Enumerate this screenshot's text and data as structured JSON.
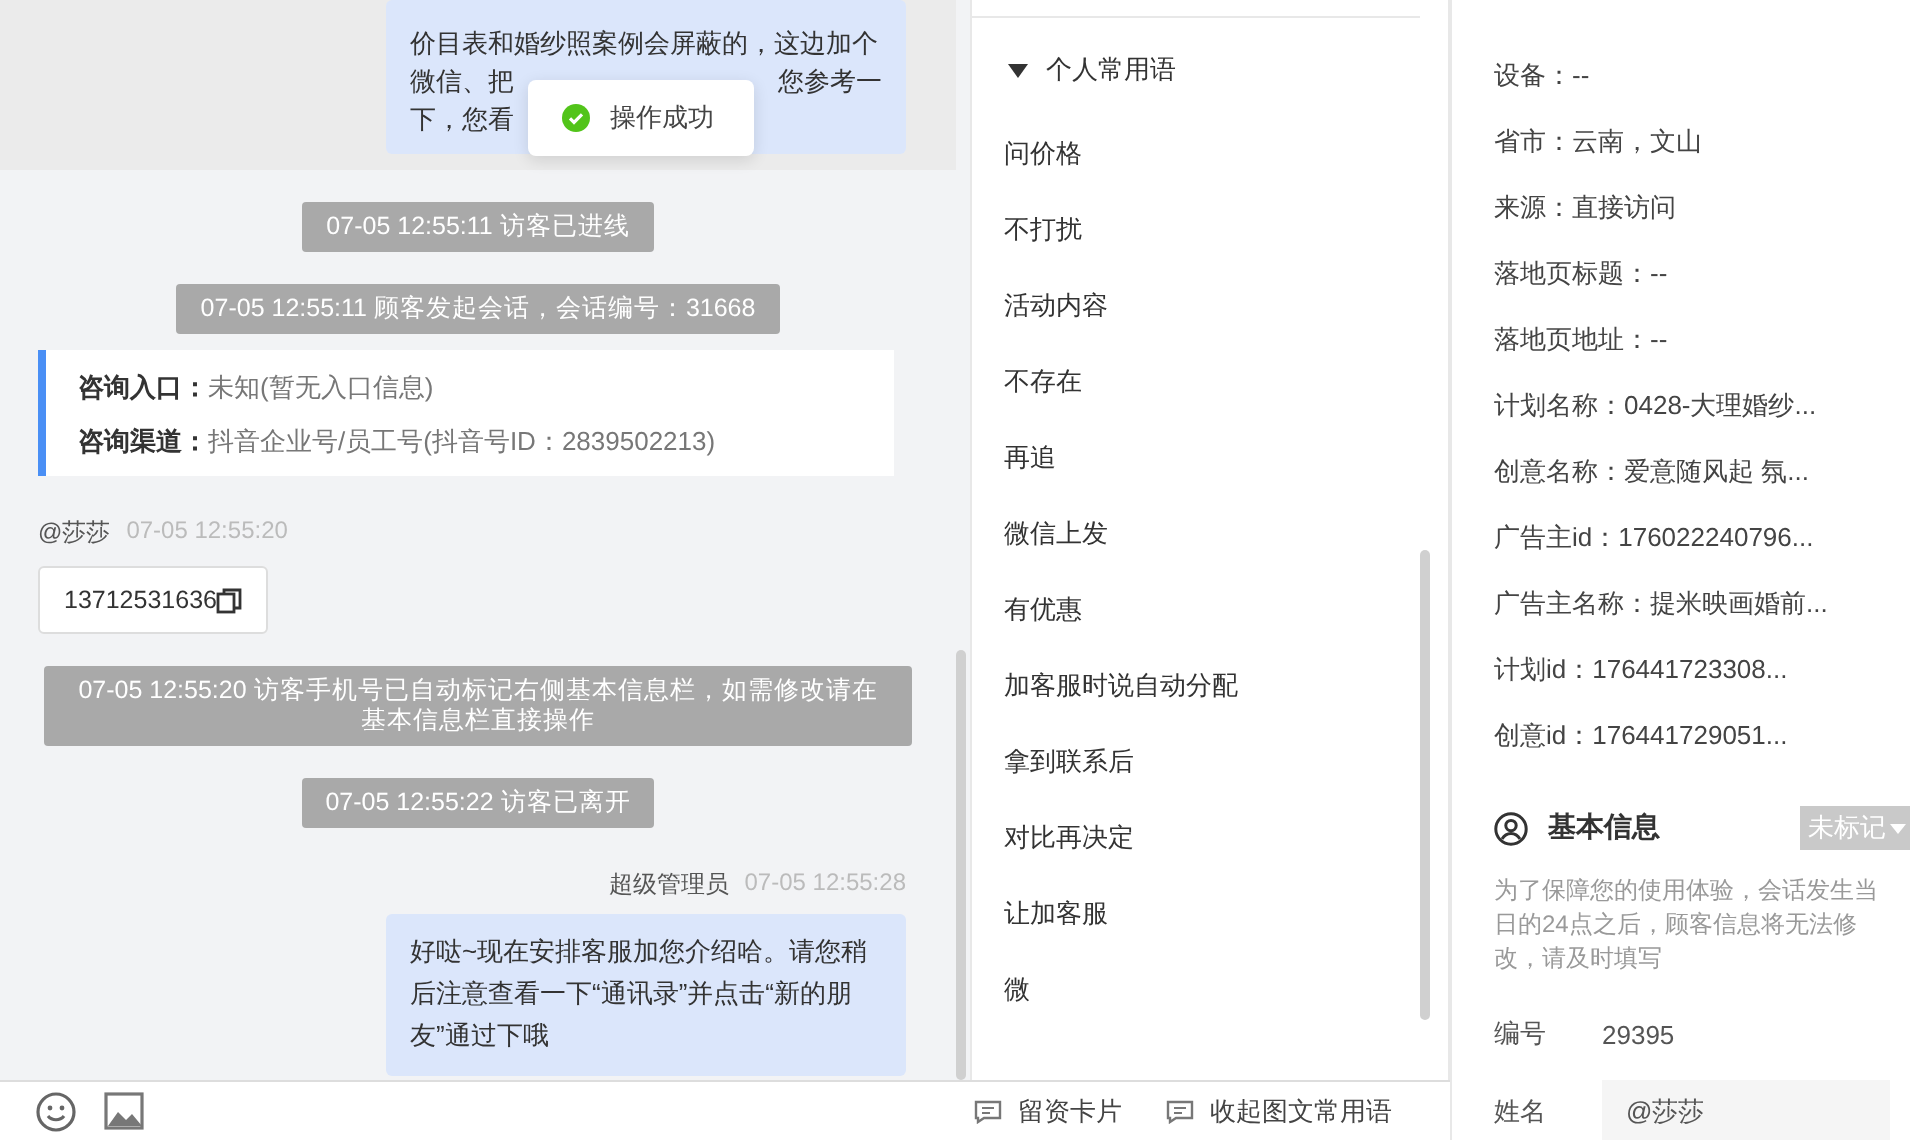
{
  "chat": {
    "messages": [
      {
        "kind": "outgoing",
        "highlighted": true,
        "lines": [
          [
            "价目表和婚纱照案例会屏蔽的，这边加个"
          ],
          [
            "微信、把",
            "您参考一"
          ],
          [
            "下，您看"
          ]
        ]
      },
      {
        "kind": "system",
        "text": "07-05 12:55:11 访客已进线"
      },
      {
        "kind": "system",
        "text": "07-05 12:55:11 顾客发起会话，会话编号：31668"
      },
      {
        "kind": "info",
        "rows": [
          {
            "label": "咨询入口：",
            "value": "未知(暂无入口信息)"
          },
          {
            "label": "咨询渠道：",
            "value": "抖音企业号/员工号(抖音号ID：2839502213)"
          }
        ]
      },
      {
        "kind": "incoming",
        "sender": "@莎莎",
        "time": "07-05 12:55:20",
        "text": "13712531636"
      },
      {
        "kind": "system",
        "text": "07-05 12:55:20 访客手机号已自动标记右侧基本信息栏，如需修改请在基本信息栏直接操作"
      },
      {
        "kind": "system",
        "text": "07-05 12:55:22 访客已离开"
      },
      {
        "kind": "outgoing",
        "sender": "超级管理员",
        "time": "07-05 12:55:28",
        "lines": [
          [
            "好哒~现在安排客服加您介绍哈。请您稍后注意查看一下“通讯录”并点击“新的朋友”通过下哦"
          ]
        ]
      }
    ]
  },
  "toast": {
    "text": "操作成功"
  },
  "quick_phrases": {
    "group": "个人常用语",
    "expanded": true,
    "items": [
      "问价格",
      "不打扰",
      "活动内容",
      "不存在",
      "再追",
      "微信上发",
      "有优惠",
      "加客服时说自动分配",
      "拿到联系后",
      "对比再决定",
      "让加客服",
      "微"
    ]
  },
  "bottom_bar": {
    "actions": [
      "留资卡片",
      "收起图文常用语"
    ]
  },
  "source_info": {
    "lines": [
      "设备：--",
      "省市：云南，文山",
      "来源：直接访问",
      "落地页标题：--",
      "落地页地址：--",
      "计划名称：0428-大理婚纱...",
      "创意名称：爱意随风起 氛...",
      "广告主id：176022240796...",
      "广告主名称：提米映画婚前...",
      "计划id：176441723308...",
      "创意id：176441729051..."
    ]
  },
  "basic_info": {
    "title": "基本信息",
    "tag": "未标记",
    "note": "为了保障您的使用体验，会话发生当日的24点之后，顾客信息将无法修改，请及时填写",
    "fields": [
      {
        "kind": "text",
        "label": "编号",
        "value": "29395"
      },
      {
        "kind": "input",
        "label": "姓名",
        "value": "@莎莎"
      }
    ]
  }
}
